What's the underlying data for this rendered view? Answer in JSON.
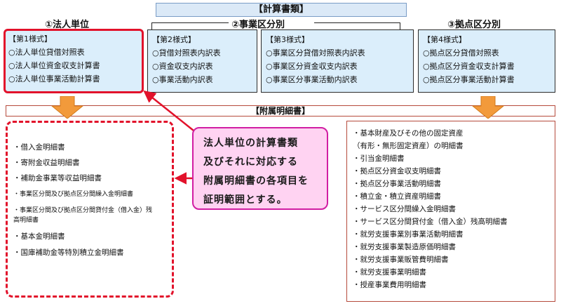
{
  "banner": {
    "title": "【計算書類】"
  },
  "categories": {
    "cat1": "①法人単位",
    "cat2": "②事業区分別",
    "cat3": "③拠点区分別"
  },
  "forms": [
    {
      "header": "【第1様式】",
      "items": [
        "○法人単位貸借対照表",
        "○法人単位資金収支計算書",
        "○法人単位事業活動計算書"
      ]
    },
    {
      "header": "【第2様式】",
      "items": [
        "○貸借対照表内訳表",
        "○資金収支内訳表",
        "○事業活動内訳表"
      ]
    },
    {
      "header": "【第3様式】",
      "items": [
        "○事業区分貸借対照表内訳表",
        "○事業区分資金収支内訳表",
        "○事業区分事業活動内訳表"
      ]
    },
    {
      "header": "【第4様式】",
      "items": [
        "○拠点区分貸借対照表",
        "○拠点区分資金収支計算書",
        "○拠点区分事業活動計算書"
      ]
    }
  ],
  "annex": {
    "title": "【附属明細書】"
  },
  "left_list": [
    "・借入金明細書",
    "・寄附金収益明細書",
    "・補助金事業等収益明細書",
    "・事業区分間及び拠点区分間繰入金明細書",
    "・事業区分間及び拠点区分間貸付金（借入金）残",
    "高明細書",
    "・基本金明細書",
    "・国庫補助金等特別積立金明細書"
  ],
  "callout": {
    "lines": [
      "法人単位の計算書類",
      "及びそれに対応する",
      "附属明細書の各項目を",
      "証明範囲とする。"
    ]
  },
  "right_list": [
    "・基本財産及びその他の固定資産",
    "（有形・無形固定資産）の明細書",
    "・引当金明細書",
    "・拠点区分資金収支明細書",
    "・拠点区分事業活動明細書",
    "・積立金・積立資産明細書",
    "・サービス区分間繰入金明細書",
    "・サービス区分間貸付金（借入金）残高明細書",
    "・就労支援事業別事業活動明細書",
    "・就労支援事業製造原価明細書",
    "・就労支援事業販管費明細書",
    "・就労支援事業明細書",
    "・授産事業費用明細書"
  ],
  "colors": {
    "accent_red": "#e2122b",
    "callout_pink": "#ffd3f2",
    "arrow_orange": "#f29a3b",
    "form_blue": "#dbeefb"
  }
}
